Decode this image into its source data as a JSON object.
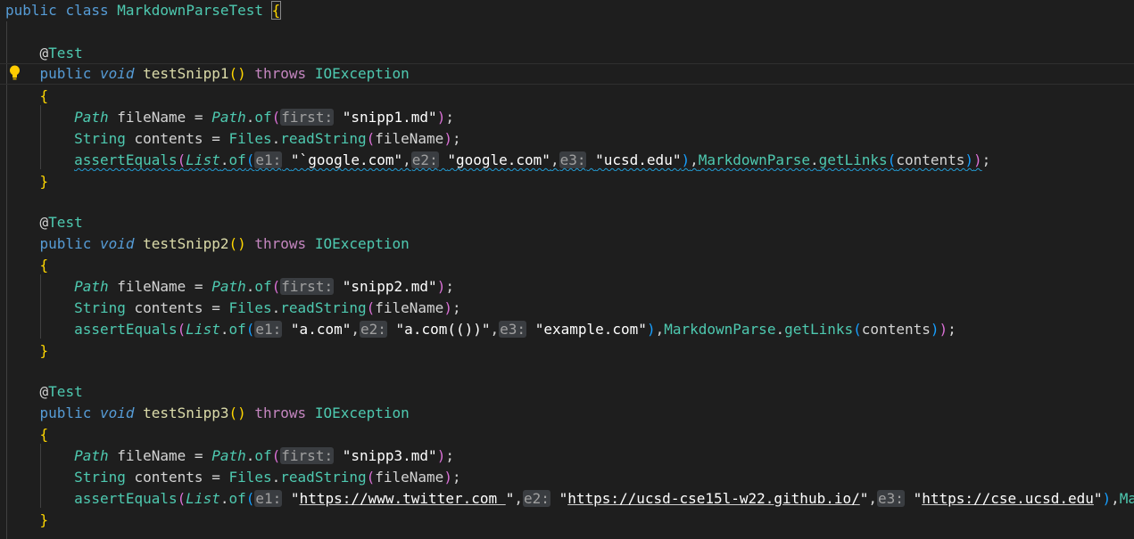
{
  "editor": {
    "class_line": {
      "public": "public",
      "class_kw": "class",
      "class_name": "MarkdownParseTest",
      "brace": "{"
    },
    "tests": [
      {
        "annotation_at": "@",
        "annotation": "Test",
        "public": "public",
        "void": "void",
        "method": "testSnipp1",
        "parens": "()",
        "throws": "throws",
        "exception": "IOException",
        "open_brace": "{",
        "close_brace": "}",
        "path_type": "Path",
        "file_var": "fileName",
        "path_cls": "Path",
        "of_fn": "of",
        "hint_first": "first:",
        "file_str": "\"snipp1.md\"",
        "string_type": "String",
        "contents_var": "contents",
        "files_cls": "Files",
        "read_fn": "readString",
        "assert_fn": "assertEquals",
        "list_cls": "List",
        "hint_e1": "e1:",
        "e1": "\"`google.com\"",
        "hint_e2": "e2:",
        "e2": "\"google.com\"",
        "hint_e3": "e3:",
        "e3": "\"ucsd.edu\"",
        "parse_cls": "MarkdownParse",
        "getlinks_fn": "getLinks"
      },
      {
        "annotation_at": "@",
        "annotation": "Test",
        "public": "public",
        "void": "void",
        "method": "testSnipp2",
        "parens": "()",
        "throws": "throws",
        "exception": "IOException",
        "open_brace": "{",
        "close_brace": "}",
        "path_type": "Path",
        "file_var": "fileName",
        "path_cls": "Path",
        "of_fn": "of",
        "hint_first": "first:",
        "file_str": "\"snipp2.md\"",
        "string_type": "String",
        "contents_var": "contents",
        "files_cls": "Files",
        "read_fn": "readString",
        "assert_fn": "assertEquals",
        "list_cls": "List",
        "hint_e1": "e1:",
        "e1": "\"a.com\"",
        "hint_e2": "e2:",
        "e2": "\"a.com(())\"",
        "hint_e3": "e3:",
        "e3": "\"example.com\"",
        "parse_cls": "MarkdownParse",
        "getlinks_fn": "getLinks"
      },
      {
        "annotation_at": "@",
        "annotation": "Test",
        "public": "public",
        "void": "void",
        "method": "testSnipp3",
        "parens": "()",
        "throws": "throws",
        "exception": "IOException",
        "open_brace": "{",
        "close_brace": "}",
        "path_type": "Path",
        "file_var": "fileName",
        "path_cls": "Path",
        "of_fn": "of",
        "hint_first": "first:",
        "file_str": "\"snipp3.md\"",
        "string_type": "String",
        "contents_var": "contents",
        "files_cls": "Files",
        "read_fn": "readString",
        "assert_fn": "assertEquals",
        "list_cls": "List",
        "hint_e1": "e1:",
        "e1_q": "\"",
        "e1_url": "https://www.twitter.com ",
        "hint_e2": "e2:",
        "e2_url": "https://ucsd-cse15l-w22.github.io/",
        "hint_e3": "e3:",
        "e3_url": "https://cse.ucsd.edu",
        "parse_cls_trunc": "Mark"
      }
    ]
  },
  "colors": {
    "background": "#1e1e1e",
    "keyword": "#569cd6",
    "control_keyword": "#c586c0",
    "type": "#4ec9b0",
    "function": "#dcdcaa",
    "variable": "#9cdcfe",
    "string": "#ce9178",
    "bracket_gold": "#ffd700",
    "bracket_purple": "#da70d6",
    "bracket_blue": "#179fff",
    "lightbulb": "#ffcc00",
    "squiggle": "#23a0d9"
  },
  "icons": {
    "gutter": "lightbulb-icon"
  }
}
